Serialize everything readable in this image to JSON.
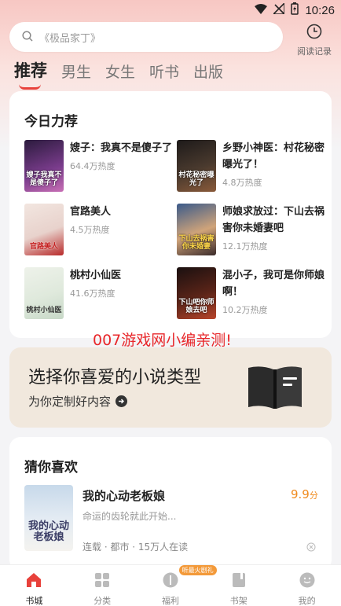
{
  "status_bar": {
    "time": "10:26"
  },
  "search": {
    "placeholder": "《极品家丁》"
  },
  "history": {
    "label": "阅读记录"
  },
  "tabs": [
    {
      "label": "推荐",
      "active": true
    },
    {
      "label": "男生"
    },
    {
      "label": "女生"
    },
    {
      "label": "听书"
    },
    {
      "label": "出版"
    }
  ],
  "recommend": {
    "title": "今日力荐",
    "books": [
      {
        "name": "嫂子：我真不是傻子了",
        "heat": "64.4万热度",
        "cover_text": "嫂子我真不是傻子了"
      },
      {
        "name": "乡野小神医：村花秘密曝光了！",
        "heat": "4.8万热度",
        "cover_text": "村花秘密曝光了"
      },
      {
        "name": "官路美人",
        "heat": "4.5万热度",
        "cover_text": "官路美人"
      },
      {
        "name": "师娘求放过：下山去祸害你未婚妻吧",
        "heat": "12.1万热度",
        "cover_text": "下山去祸害你未婚妻"
      },
      {
        "name": "桃村小仙医",
        "heat": "41.6万热度",
        "cover_text": "桃村小仙医"
      },
      {
        "name": "混小子，我可是你师娘啊！",
        "heat": "10.2万热度",
        "cover_text": "下山吧你师娘去吧"
      }
    ]
  },
  "watermark": "007游戏网小编亲测!",
  "banner": {
    "title": "选择你喜爱的小说类型",
    "subtitle": "为你定制好内容"
  },
  "guess": {
    "title": "猜你喜欢",
    "book": {
      "name": "我的心动老板娘",
      "score": "9.9",
      "score_unit": "分",
      "desc": "命运的齿轮就此开始...",
      "meta": "连载 · 都市 · 15万人在读",
      "cover_text": "我的心动老板娘"
    }
  },
  "nav": [
    {
      "label": "书城",
      "icon": "home-icon",
      "active": true
    },
    {
      "label": "分类",
      "icon": "grid-icon"
    },
    {
      "label": "福利",
      "icon": "gift-icon",
      "badge": "听最火剧礼"
    },
    {
      "label": "书架",
      "icon": "bookshelf-icon"
    },
    {
      "label": "我的",
      "icon": "profile-icon"
    }
  ],
  "colors": {
    "accent": "#e8413b",
    "score": "#f08c20"
  }
}
